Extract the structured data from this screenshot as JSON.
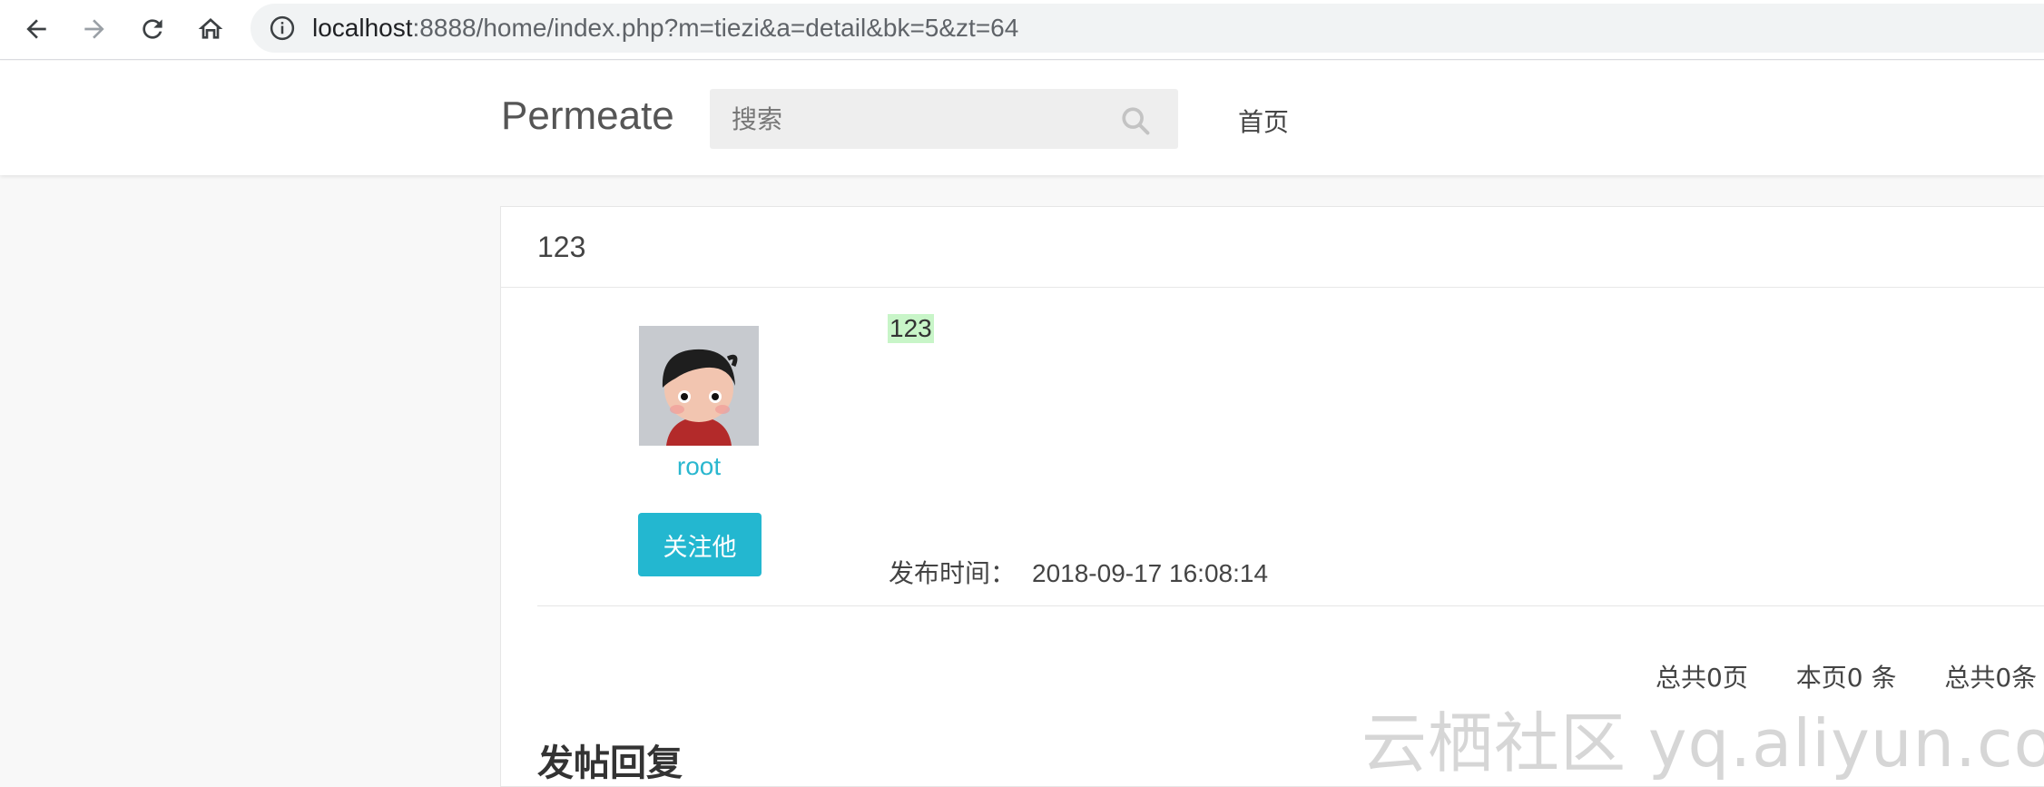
{
  "browser": {
    "url_host": "localhost",
    "url_rest": ":8888/home/index.php?m=tiezi&a=detail&bk=5&zt=64"
  },
  "header": {
    "brand": "Permeate",
    "search_placeholder": "搜索",
    "nav_home": "首页"
  },
  "post": {
    "title": "123",
    "author": "root",
    "follow_label": "关注他",
    "content": "123",
    "time_label": "发布时间：",
    "time_value": "2018-09-17 16:08:14"
  },
  "pagination": {
    "total_pages": "总共0页",
    "this_page": "本页0 条",
    "total_items": "总共0条"
  },
  "reply": {
    "heading": "发帖回复"
  },
  "watermark": "云栖社区 yq.aliyun.com",
  "colors": {
    "accent": "#23b7d0",
    "link": "#2ab7cf",
    "highlight": "#c8f5c8"
  }
}
